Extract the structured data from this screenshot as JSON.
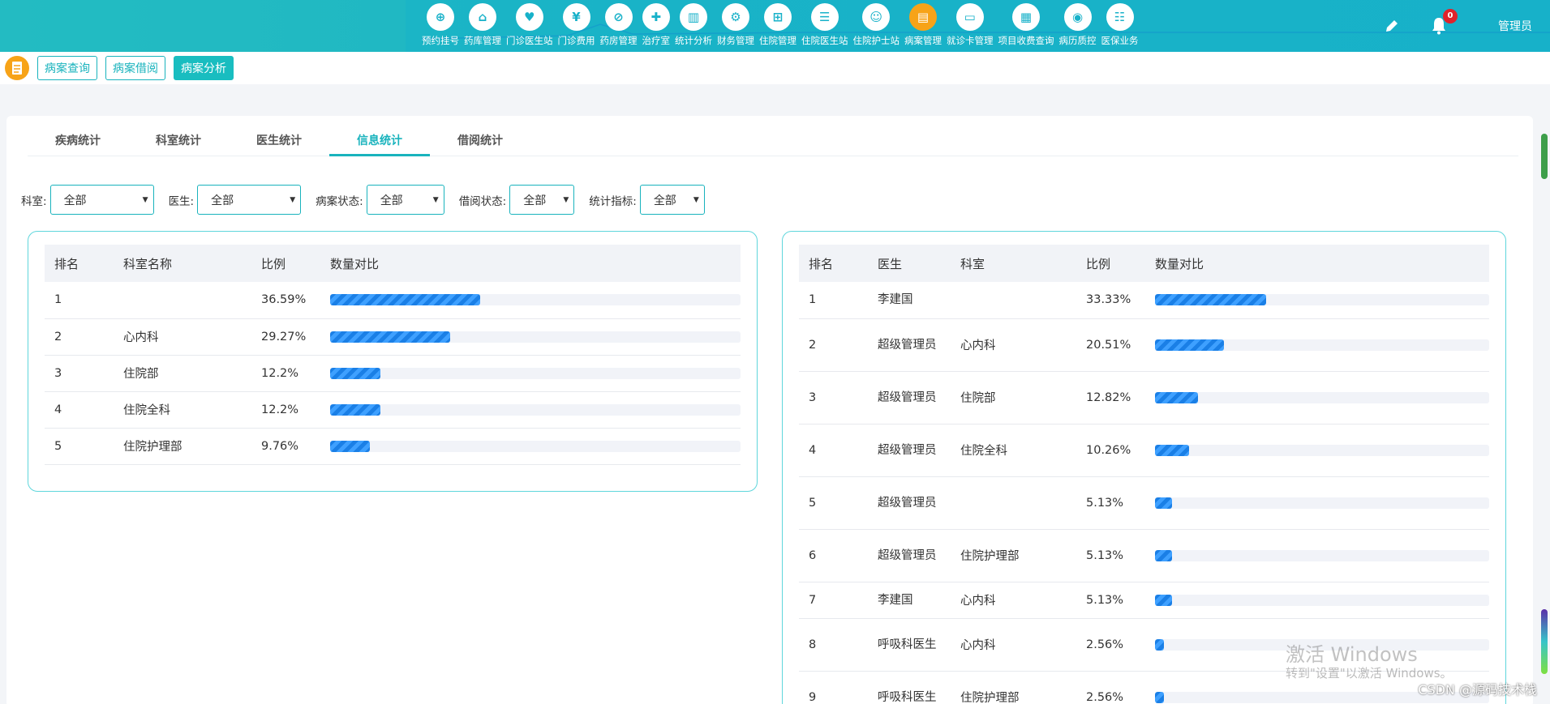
{
  "nav": {
    "items": [
      {
        "label": "预约挂号",
        "icon": "appointment-icon",
        "glyph": "⊕"
      },
      {
        "label": "药库管理",
        "icon": "pharmacy-store-icon",
        "glyph": "⌂"
      },
      {
        "label": "门诊医生站",
        "icon": "outpatient-doctor-icon",
        "glyph": "♥"
      },
      {
        "label": "门诊费用",
        "icon": "yen-icon",
        "glyph": "¥"
      },
      {
        "label": "药房管理",
        "icon": "pill-icon",
        "glyph": "⊘"
      },
      {
        "label": "治疗室",
        "icon": "treatment-icon",
        "glyph": "✚"
      },
      {
        "label": "统计分析",
        "icon": "chart-icon",
        "glyph": "▥"
      },
      {
        "label": "财务管理",
        "icon": "finance-gear-icon",
        "glyph": "⚙"
      },
      {
        "label": "住院管理",
        "icon": "bed-icon",
        "glyph": "⊞"
      },
      {
        "label": "住院医生站",
        "icon": "inpatient-doctor-icon",
        "glyph": "☰"
      },
      {
        "label": "住院护士站",
        "icon": "nurse-icon",
        "glyph": "☺"
      },
      {
        "label": "病案管理",
        "icon": "medical-record-icon",
        "glyph": "▤"
      },
      {
        "label": "就诊卡管理",
        "icon": "card-icon",
        "glyph": "▭"
      },
      {
        "label": "项目收费查询",
        "icon": "receipt-icon",
        "glyph": "▦"
      },
      {
        "label": "病历质控",
        "icon": "quality-control-icon",
        "glyph": "◉"
      },
      {
        "label": "医保业务",
        "icon": "insurance-icon",
        "glyph": "☷"
      }
    ],
    "active_index": 11
  },
  "header": {
    "notification_count": "0",
    "username": "管理员"
  },
  "subnav": {
    "buttons": [
      "病案查询",
      "病案借阅",
      "病案分析"
    ],
    "active": "病案分析"
  },
  "tabs": {
    "items": [
      "疾病统计",
      "科室统计",
      "医生统计",
      "信息统计",
      "借阅统计"
    ],
    "active": "信息统计"
  },
  "filters": [
    {
      "label": "科室:",
      "value": "全部"
    },
    {
      "label": "医生:",
      "value": "全部"
    },
    {
      "label": "病案状态:",
      "value": "全部"
    },
    {
      "label": "借阅状态:",
      "value": "全部"
    },
    {
      "label": "统计指标:",
      "value": "全部"
    }
  ],
  "dept_table": {
    "headers": [
      "排名",
      "科室名称",
      "比例",
      "数量对比"
    ],
    "rows": [
      {
        "rank": "1",
        "dept": "",
        "ratio": "36.59%",
        "fill": 0.3659
      },
      {
        "rank": "2",
        "dept": "心内科",
        "ratio": "29.27%",
        "fill": 0.2927
      },
      {
        "rank": "3",
        "dept": "住院部",
        "ratio": "12.2%",
        "fill": 0.122
      },
      {
        "rank": "4",
        "dept": "住院全科",
        "ratio": "12.2%",
        "fill": 0.122
      },
      {
        "rank": "5",
        "dept": "住院护理部",
        "ratio": "9.76%",
        "fill": 0.0976
      }
    ]
  },
  "doctor_table": {
    "headers": [
      "排名",
      "医生",
      "科室",
      "比例",
      "数量对比"
    ],
    "rows": [
      {
        "rank": "1",
        "doctor": "李建国",
        "dept": "",
        "ratio": "33.33%",
        "fill": 0.3333
      },
      {
        "rank": "2",
        "doctor": "超级管理员",
        "dept": "心内科",
        "ratio": "20.51%",
        "fill": 0.2051
      },
      {
        "rank": "3",
        "doctor": "超级管理员",
        "dept": "住院部",
        "ratio": "12.82%",
        "fill": 0.1282
      },
      {
        "rank": "4",
        "doctor": "超级管理员",
        "dept": "住院全科",
        "ratio": "10.26%",
        "fill": 0.1026
      },
      {
        "rank": "5",
        "doctor": "超级管理员",
        "dept": "",
        "ratio": "5.13%",
        "fill": 0.0513
      },
      {
        "rank": "6",
        "doctor": "超级管理员",
        "dept": "住院护理部",
        "ratio": "5.13%",
        "fill": 0.0513
      },
      {
        "rank": "7",
        "doctor": "李建国",
        "dept": "心内科",
        "ratio": "5.13%",
        "fill": 0.0513
      },
      {
        "rank": "8",
        "doctor": "呼吸科医生",
        "dept": "心内科",
        "ratio": "2.56%",
        "fill": 0.0256
      },
      {
        "rank": "9",
        "doctor": "呼吸科医生",
        "dept": "住院护理部",
        "ratio": "2.56%",
        "fill": 0.0256
      }
    ]
  },
  "watermark": {
    "line1": "激活 Windows",
    "line2": "转到\"设置\"以激活 Windows。",
    "csdn": "CSDN @源码技术栈"
  },
  "colors": {
    "accent": "#19b3bd",
    "active_nav": "#f7a318",
    "bar": "#1a7fe6"
  }
}
